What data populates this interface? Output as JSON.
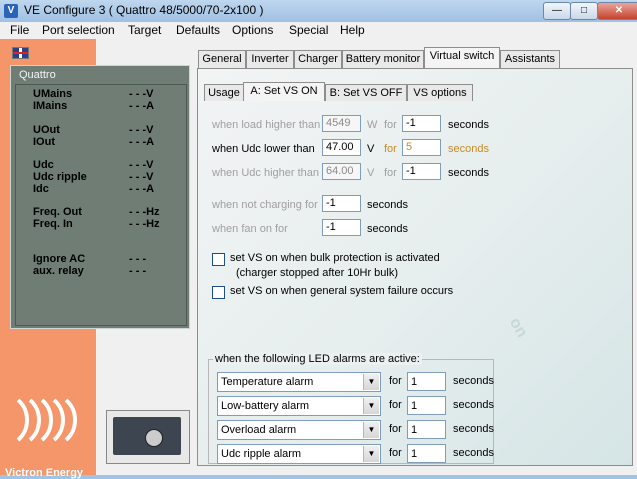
{
  "window": {
    "title": "VE Configure 3    ( Quattro 48/5000/70-2x100 )"
  },
  "menu": [
    "File",
    "Port selection",
    "Target",
    "Defaults",
    "Options",
    "Special",
    "Help"
  ],
  "status": {
    "device": "Quattro",
    "rows": [
      {
        "label": "UMains",
        "value": "- - -V"
      },
      {
        "label": "IMains",
        "value": "- - -A"
      },
      {
        "label": "UOut",
        "value": "- - -V"
      },
      {
        "label": "IOut",
        "value": "- - -A"
      },
      {
        "label": "Udc",
        "value": "- - -V"
      },
      {
        "label": "Udc ripple",
        "value": "- - -V"
      },
      {
        "label": "Idc",
        "value": "- - -A"
      },
      {
        "label": "Freq. Out",
        "value": "- - -Hz"
      },
      {
        "label": "Freq. In",
        "value": "- - -Hz"
      },
      {
        "label": "Ignore AC",
        "value": "- - -"
      },
      {
        "label": "aux. relay",
        "value": "- - -"
      }
    ]
  },
  "brand": "Victron Energy",
  "tabs": [
    "General",
    "Inverter",
    "Charger",
    "Battery monitor",
    "Virtual switch",
    "Assistants"
  ],
  "subtabs": [
    "Usage",
    "A:  Set VS ON",
    "B:  Set VS OFF",
    "VS options"
  ],
  "form": {
    "load": {
      "label": "when load higher than",
      "value": "4549",
      "unit": "W",
      "for": "for",
      "time": "-1",
      "seconds": "seconds"
    },
    "udc_low": {
      "label": "when Udc lower than",
      "value": "47.00",
      "unit": "V",
      "for": "for",
      "time": "5",
      "seconds": "seconds"
    },
    "udc_high": {
      "label": "when Udc higher than",
      "value": "64.00",
      "unit": "V",
      "for": "for",
      "time": "-1",
      "seconds": "seconds"
    },
    "not_charging": {
      "label": "when not charging for",
      "time": "-1",
      "seconds": "seconds"
    },
    "fan_on": {
      "label": "when fan on for",
      "time": "-1",
      "seconds": "seconds"
    },
    "bulk": {
      "label": "set VS on when bulk protection is activated",
      "sub": "(charger stopped after 10Hr bulk)"
    },
    "failure": {
      "label": "set VS on when general system failure occurs"
    }
  },
  "alarms": {
    "title": "when the following LED alarms are active:",
    "rows": [
      {
        "select": "Temperature alarm",
        "for": "for",
        "time": "1",
        "seconds": "seconds"
      },
      {
        "select": "Low-battery alarm",
        "for": "for",
        "time": "1",
        "seconds": "seconds"
      },
      {
        "select": "Overload alarm",
        "for": "for",
        "time": "1",
        "seconds": "seconds"
      },
      {
        "select": "Udc ripple alarm",
        "for": "for",
        "time": "1",
        "seconds": "seconds"
      }
    ]
  },
  "colors": {
    "accent": "#f4956a",
    "status_panel": "#6f7d74",
    "disabled_text": "#a0a0a0",
    "active_orange": "#c58c2a"
  }
}
